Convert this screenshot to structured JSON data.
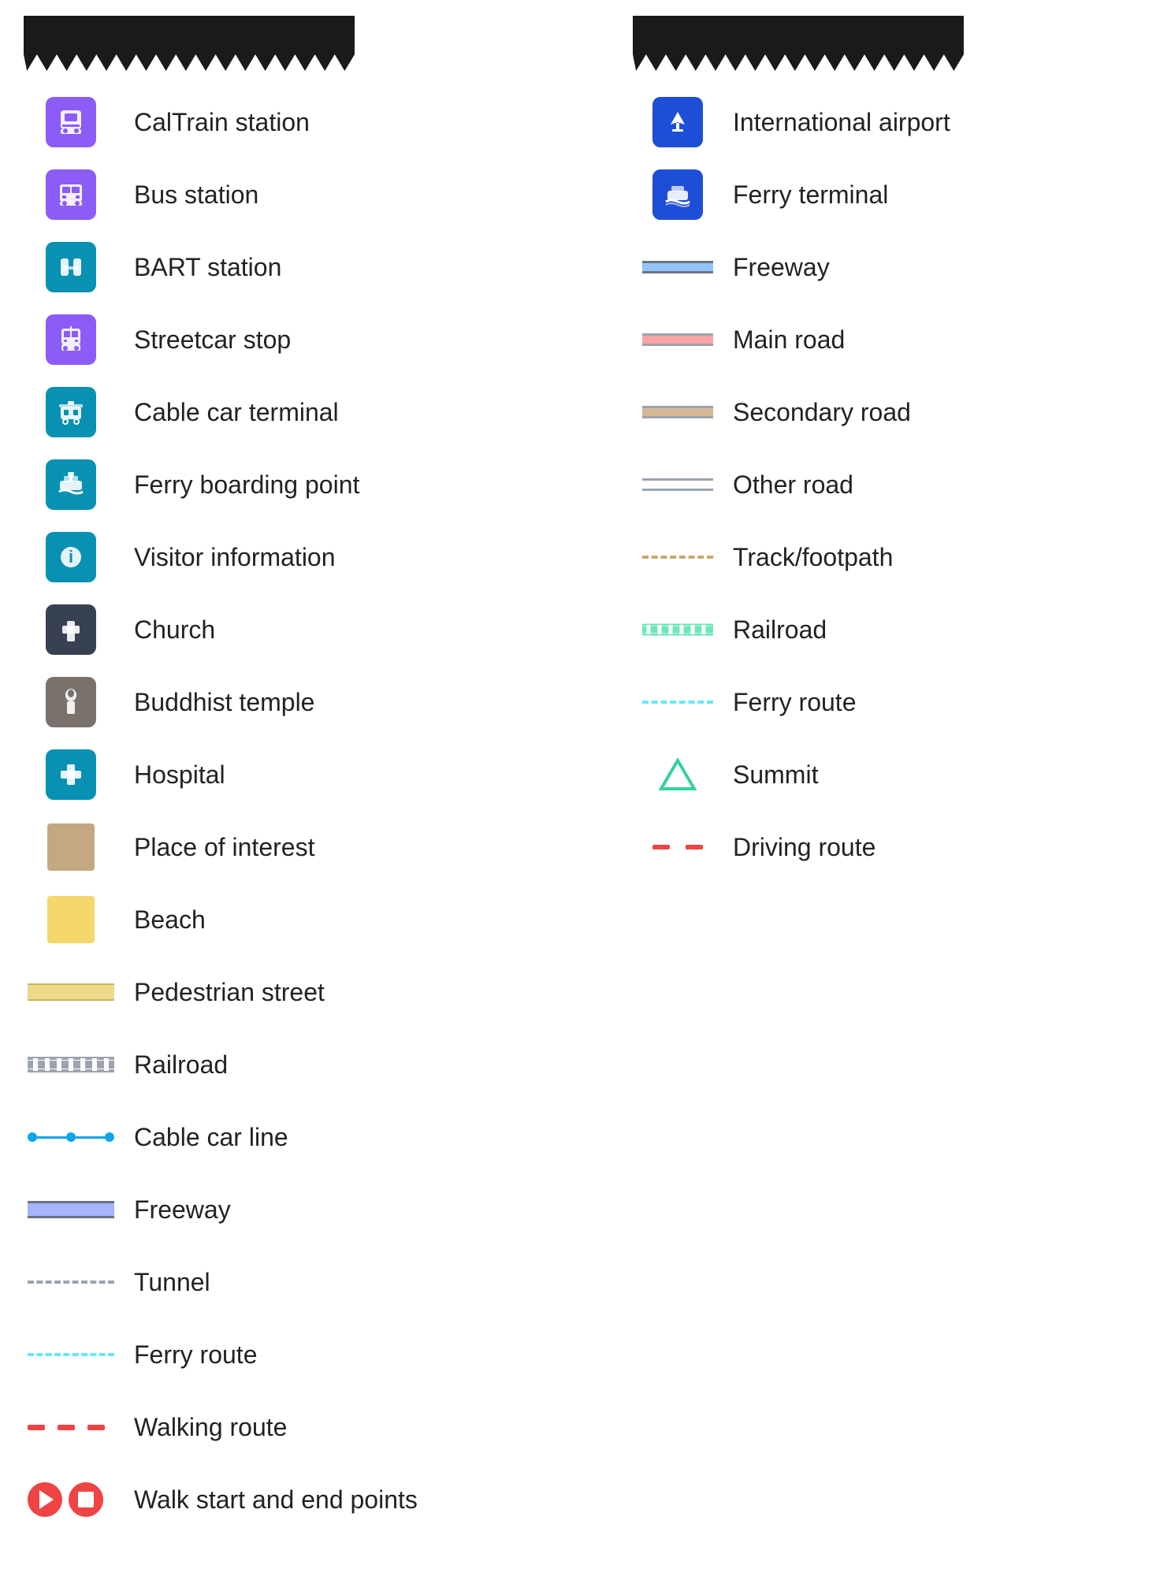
{
  "page": {
    "background": "#ffffff"
  },
  "left_column": {
    "items": [
      {
        "id": "caltrain",
        "label": "CalTrain station",
        "icon_type": "box",
        "icon_color": "#8B5CF6",
        "icon_symbol": "train"
      },
      {
        "id": "bus",
        "label": "Bus station",
        "icon_type": "box",
        "icon_color": "#8B5CF6",
        "icon_symbol": "bus"
      },
      {
        "id": "bart",
        "label": "BART station",
        "icon_type": "box",
        "icon_color": "#0891B2",
        "icon_symbol": "bart"
      },
      {
        "id": "streetcar",
        "label": "Streetcar stop",
        "icon_type": "box",
        "icon_color": "#8B5CF6",
        "icon_symbol": "streetcar"
      },
      {
        "id": "cablecar",
        "label": "Cable car terminal",
        "icon_type": "box",
        "icon_color": "#0891B2",
        "icon_symbol": "cablecar"
      },
      {
        "id": "ferry-boarding",
        "label": "Ferry boarding point",
        "icon_type": "box",
        "icon_color": "#0891B2",
        "icon_symbol": "ferry"
      },
      {
        "id": "visitor",
        "label": "Visitor information",
        "icon_type": "box",
        "icon_color": "#0891B2",
        "icon_symbol": "info"
      },
      {
        "id": "church",
        "label": "Church",
        "icon_type": "box",
        "icon_color": "#374151",
        "icon_symbol": "cross"
      },
      {
        "id": "buddhist",
        "label": "Buddhist temple",
        "icon_type": "box",
        "icon_color": "#6B7280",
        "icon_symbol": "buddhist"
      },
      {
        "id": "hospital",
        "label": "Hospital",
        "icon_type": "box",
        "icon_color": "#0891B2",
        "icon_symbol": "hospital"
      },
      {
        "id": "poi",
        "label": "Place of interest",
        "icon_type": "colored-box",
        "color": "#C4A882"
      },
      {
        "id": "beach",
        "label": "Beach",
        "icon_type": "colored-box",
        "color": "#F6D76B"
      },
      {
        "id": "pedestrian",
        "label": "Pedestrian street",
        "icon_type": "line-pedestrian"
      },
      {
        "id": "railroad-l",
        "label": "Railroad",
        "icon_type": "line-railroad-l"
      },
      {
        "id": "cablecar-line",
        "label": "Cable car line",
        "icon_type": "cable-car-line"
      },
      {
        "id": "freeway-l",
        "label": "Freeway",
        "icon_type": "line-freeway-l"
      },
      {
        "id": "tunnel",
        "label": "Tunnel",
        "icon_type": "line-tunnel"
      },
      {
        "id": "ferry-l",
        "label": "Ferry route",
        "icon_type": "line-ferry-l"
      },
      {
        "id": "walking",
        "label": "Walking route",
        "icon_type": "walking-route"
      },
      {
        "id": "walk-points",
        "label": "Walk start and end points",
        "icon_type": "walk-points"
      }
    ]
  },
  "right_column": {
    "items": [
      {
        "id": "airport",
        "label": "International airport",
        "icon_type": "box",
        "icon_color": "#1D4ED8",
        "icon_symbol": "plane"
      },
      {
        "id": "ferry-terminal",
        "label": "Ferry terminal",
        "icon_type": "box",
        "icon_color": "#1D4ED8",
        "icon_symbol": "ship"
      },
      {
        "id": "freeway",
        "label": "Freeway",
        "icon_type": "line-freeway"
      },
      {
        "id": "main-road",
        "label": "Main road",
        "icon_type": "line-main-road"
      },
      {
        "id": "secondary-road",
        "label": "Secondary road",
        "icon_type": "line-secondary-road"
      },
      {
        "id": "other-road",
        "label": "Other road",
        "icon_type": "line-other-road"
      },
      {
        "id": "track",
        "label": "Track/footpath",
        "icon_type": "line-track"
      },
      {
        "id": "railroad-r",
        "label": "Railroad",
        "icon_type": "line-railroad-r"
      },
      {
        "id": "ferry-r",
        "label": "Ferry route",
        "icon_type": "line-ferry-r"
      },
      {
        "id": "summit",
        "label": "Summit",
        "icon_type": "triangle"
      },
      {
        "id": "driving",
        "label": "Driving route",
        "icon_type": "driving-route"
      }
    ]
  }
}
